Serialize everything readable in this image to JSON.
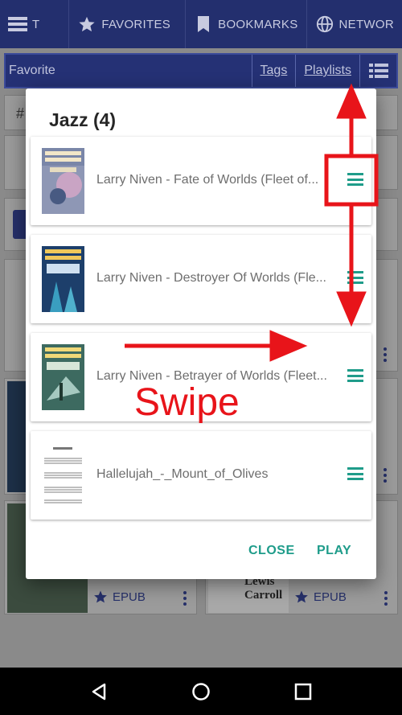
{
  "tabs": [
    {
      "label": "T",
      "icon": "menu-icon"
    },
    {
      "label": "FAVORITES",
      "icon": "star-icon"
    },
    {
      "label": "BOOKMARKS",
      "icon": "bookmark-icon"
    },
    {
      "label": "NETWOR",
      "icon": "globe-icon"
    }
  ],
  "subbar": {
    "title": "Favorite",
    "tags_label": "Tags",
    "playlists_label": "Playlists",
    "icon": "list-icon"
  },
  "background": {
    "hash_fragment": "#",
    "format_label": "EPUB",
    "format_label_2": "EPUB",
    "author_fragment": "Lewis\nCarroll"
  },
  "dialog": {
    "title": "Jazz (4)",
    "items": [
      {
        "name": "Larry Niven - Fate of Worlds (Fleet of...",
        "cover_color": "#5d6f8f",
        "cover_text": "LARRY NIVEN and EDWARD M. LERNER"
      },
      {
        "name": "Larry Niven - Destroyer Of Worlds (Fle...",
        "cover_color": "#1d3f6b",
        "cover_text": "LARRY NIVEN and EDWARD M. LERNER"
      },
      {
        "name": "Larry Niven - Betrayer of Worlds (Fleet...",
        "cover_color": "#3d6a60",
        "cover_text": "LARRY NIVEN and EDWARD M. LERNER"
      },
      {
        "name": "Hallelujah_-_Mount_of_Olives",
        "cover_color": "#ffffff",
        "cover_text": ""
      }
    ],
    "close_label": "CLOSE",
    "play_label": "PLAY"
  },
  "annotation": {
    "swipe_label": "Swipe"
  },
  "colors": {
    "primary": "#232f6e",
    "accent": "#1e9c8a",
    "annotation": "#e8141a"
  }
}
